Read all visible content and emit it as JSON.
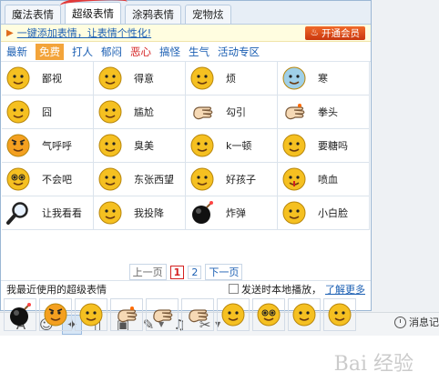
{
  "tabs": [
    "魔法表情",
    "超级表情",
    "涂鸦表情",
    "宠物炫"
  ],
  "active_tab": 1,
  "promo": {
    "text": "一键添加表情，让表情个性化!",
    "vip_button": "开通会员"
  },
  "categories": [
    "最新",
    "免费",
    "打人",
    "郁闷",
    "恶心",
    "搞怪",
    "生气",
    "活动专区"
  ],
  "selected_category": 1,
  "emoticons": [
    {
      "label": "鄙视",
      "icon": "disdain-face-icon"
    },
    {
      "label": "得意",
      "icon": "smug-face-icon"
    },
    {
      "label": "烦",
      "icon": "annoyed-face-icon"
    },
    {
      "label": "寒",
      "icon": "chill-face-icon"
    },
    {
      "label": "囧",
      "icon": "jiong-face-icon"
    },
    {
      "label": "尴尬",
      "icon": "awkward-face-icon"
    },
    {
      "label": "勾引",
      "icon": "beckon-hand-icon"
    },
    {
      "label": "拳头",
      "icon": "fist-icon"
    },
    {
      "label": "气呼呼",
      "icon": "angry-face-icon"
    },
    {
      "label": "臭美",
      "icon": "vain-face-icon"
    },
    {
      "label": "k一顿",
      "icon": "beat-up-face-icon"
    },
    {
      "label": "要糖吗",
      "icon": "candy-face-icon"
    },
    {
      "label": "不会吧",
      "icon": "shocked-face-icon"
    },
    {
      "label": "东张西望",
      "icon": "looking-around-face-icon"
    },
    {
      "label": "好孩子",
      "icon": "good-kid-face-icon"
    },
    {
      "label": "喷血",
      "icon": "nosebleed-face-icon"
    },
    {
      "label": "让我看看",
      "icon": "magnifier-icon"
    },
    {
      "label": "我投降",
      "icon": "surrender-face-icon"
    },
    {
      "label": "炸弹",
      "icon": "bomb-icon"
    },
    {
      "label": "小白脸",
      "icon": "pale-face-icon"
    }
  ],
  "pager": {
    "prev": "上一页",
    "pages": [
      "1",
      "2"
    ],
    "current": "1",
    "next": "下一页"
  },
  "recent": {
    "title": "我最近使用的超级表情",
    "send_local": "发送时本地播放，",
    "learn_more": "了解更多",
    "icons": [
      "bomb-icon",
      "angry-face-icon",
      "vain-face-icon",
      "fist-icon",
      "beckon-hand-icon",
      "beckon-hand-icon",
      "candy-face-icon",
      "shocked-face-icon",
      "smug-face-icon",
      "annoyed-face-icon"
    ]
  },
  "toolbar": {
    "icons": [
      "font-icon",
      "smiley-icon",
      "magic-wand-icon",
      "vibrate-icon",
      "image-icon",
      "edit-image-icon",
      "music-icon",
      "scissors-icon"
    ],
    "message_record": "消息记"
  },
  "watermark": "Bai 经验",
  "colors": {
    "accent": "#1b5fb3",
    "face_yellow": "#f5c021",
    "selected_category": "#f3a43a",
    "vip": "#d8481b"
  }
}
